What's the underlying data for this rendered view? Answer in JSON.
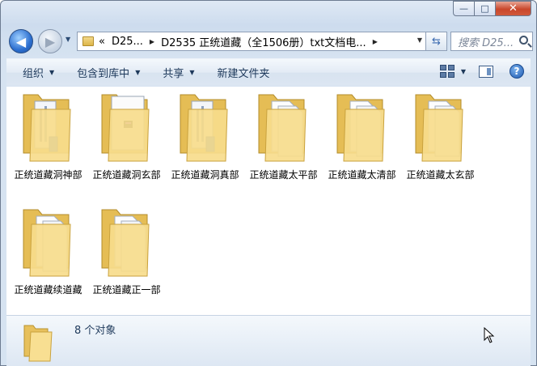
{
  "window": {
    "controls": {
      "minimize": "—",
      "maximize": "□",
      "close": "✕"
    }
  },
  "nav": {
    "back_icon": "back-arrow-icon",
    "forward_icon": "forward-arrow-icon",
    "breadcrumb_prefix": "«",
    "crumbs": [
      "D25...",
      "D2535 正统道藏（全1506册）txt文档电..."
    ],
    "search_placeholder": "搜索 D25..."
  },
  "toolbar": {
    "organize": "组织",
    "include_in_library": "包含到库中",
    "share": "共享",
    "new_folder": "新建文件夹"
  },
  "folders": [
    {
      "name": "正统道藏洞神部",
      "style": "docs-blue"
    },
    {
      "name": "正统道藏洞玄部",
      "style": "image"
    },
    {
      "name": "正统道藏洞真部",
      "style": "docs-blue"
    },
    {
      "name": "正统道藏太平部",
      "style": "pages"
    },
    {
      "name": "正统道藏太清部",
      "style": "pages"
    },
    {
      "name": "正统道藏太玄部",
      "style": "pages"
    },
    {
      "name": "正统道藏续道藏",
      "style": "pages"
    },
    {
      "name": "正统道藏正一部",
      "style": "pages"
    }
  ],
  "status": {
    "count_text": "8 个对象"
  }
}
